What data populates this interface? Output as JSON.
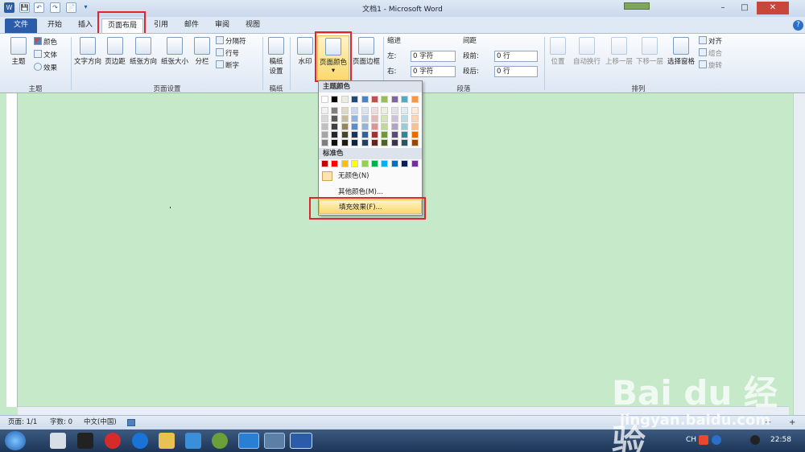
{
  "window": {
    "title": "文档1 - Microsoft Word",
    "controls": [
      "–",
      "□",
      "✕"
    ]
  },
  "quick_access": [
    "W",
    "💾",
    "↶",
    "↷",
    "📄",
    "▾"
  ],
  "tabs": [
    {
      "label": "文件"
    },
    {
      "label": "开始"
    },
    {
      "label": "插入"
    },
    {
      "label": "页面布局"
    },
    {
      "label": "引用"
    },
    {
      "label": "邮件"
    },
    {
      "label": "审阅"
    },
    {
      "label": "视图"
    }
  ],
  "help_icon": "?",
  "ribbon": {
    "theme": {
      "main": "主题",
      "color": "颜色",
      "font": "文体",
      "effect": "效果",
      "group": "主题"
    },
    "page_setup": {
      "text_direction": "文字方向",
      "margins": "页边距",
      "orientation": "纸张方向",
      "size": "纸张大小",
      "columns": "分栏",
      "breaks": "分隔符",
      "line_numbers": "行号",
      "hyphenation": "断字",
      "group": "页面设置"
    },
    "manuscript": {
      "label_1": "稿纸",
      "label_2": "设置",
      "group": "稿纸"
    },
    "page_background": {
      "watermark": "水印",
      "page_color": "页面颜色",
      "page_border": "页面边框"
    },
    "paragraph": {
      "indent": "缩进",
      "left": "左:",
      "right": "右:",
      "left_value": "0 字符",
      "right_value": "0 字符",
      "spacing": "间距",
      "before": "段前:",
      "after": "段后:",
      "before_value": "0 行",
      "after_value": "0 行",
      "group": "段落"
    },
    "arrange": {
      "position": "位置",
      "wrap": "自动换行",
      "bring_forward": "上移一层",
      "send_backward": "下移一层",
      "selection_pane": "选择窗格",
      "align": "对齐",
      "group_objects": "组合",
      "rotate": "旋转",
      "group": "排列"
    }
  },
  "color_menu": {
    "theme_header": "主题颜色",
    "standard_header": "标准色",
    "no_color": "无颜色(N)",
    "more_colors": "其他颜色(M)...",
    "fill_effects": "填充效果(F)...",
    "theme_colors": [
      [
        "#ffffff",
        "#000000",
        "#eeece1",
        "#1f497d",
        "#4f81bd",
        "#c0504d",
        "#9bbb59",
        "#8064a2",
        "#4bacc6",
        "#f79646"
      ],
      [
        "#f2f2f2",
        "#7f7f7f",
        "#ddd9c3",
        "#c6d9f0",
        "#dbe5f1",
        "#f2dcdb",
        "#ebf1dd",
        "#e5e0ec",
        "#dbeef3",
        "#fdeada"
      ],
      [
        "#d8d8d8",
        "#595959",
        "#c4bd97",
        "#8db3e2",
        "#b8cce4",
        "#e5b9b7",
        "#d7e3bc",
        "#ccc1d9",
        "#b7dde8",
        "#fbd5b5"
      ],
      [
        "#bfbfbf",
        "#3f3f3f",
        "#938953",
        "#548dd4",
        "#95b3d7",
        "#d99694",
        "#c3d69b",
        "#b2a2c7",
        "#92cddc",
        "#fac08f"
      ],
      [
        "#a5a5a5",
        "#262626",
        "#494429",
        "#17365d",
        "#366092",
        "#953734",
        "#76923c",
        "#5f497a",
        "#31859b",
        "#e36c09"
      ],
      [
        "#7f7f7f",
        "#0c0c0c",
        "#1d1b10",
        "#0f243e",
        "#244061",
        "#632423",
        "#4f6128",
        "#3f3151",
        "#205867",
        "#974806"
      ]
    ],
    "standard_colors": [
      "#c00000",
      "#ff0000",
      "#ffc000",
      "#ffff00",
      "#92d050",
      "#00b050",
      "#00b0f0",
      "#0070c0",
      "#002060",
      "#7030a0"
    ]
  },
  "statusbar": {
    "page": "页面: 1/1",
    "words": "字数: 0",
    "language": "中文(中国)"
  },
  "taskbar": {
    "ime": "CH",
    "time": "22:58"
  },
  "watermark": {
    "brand": "Bai du 经验",
    "url": "jingyan.baidu.com"
  },
  "colors": {
    "page_bg": "#c6e9c9",
    "file_tab": "#2a5caa",
    "highlight": "#e0262c"
  }
}
